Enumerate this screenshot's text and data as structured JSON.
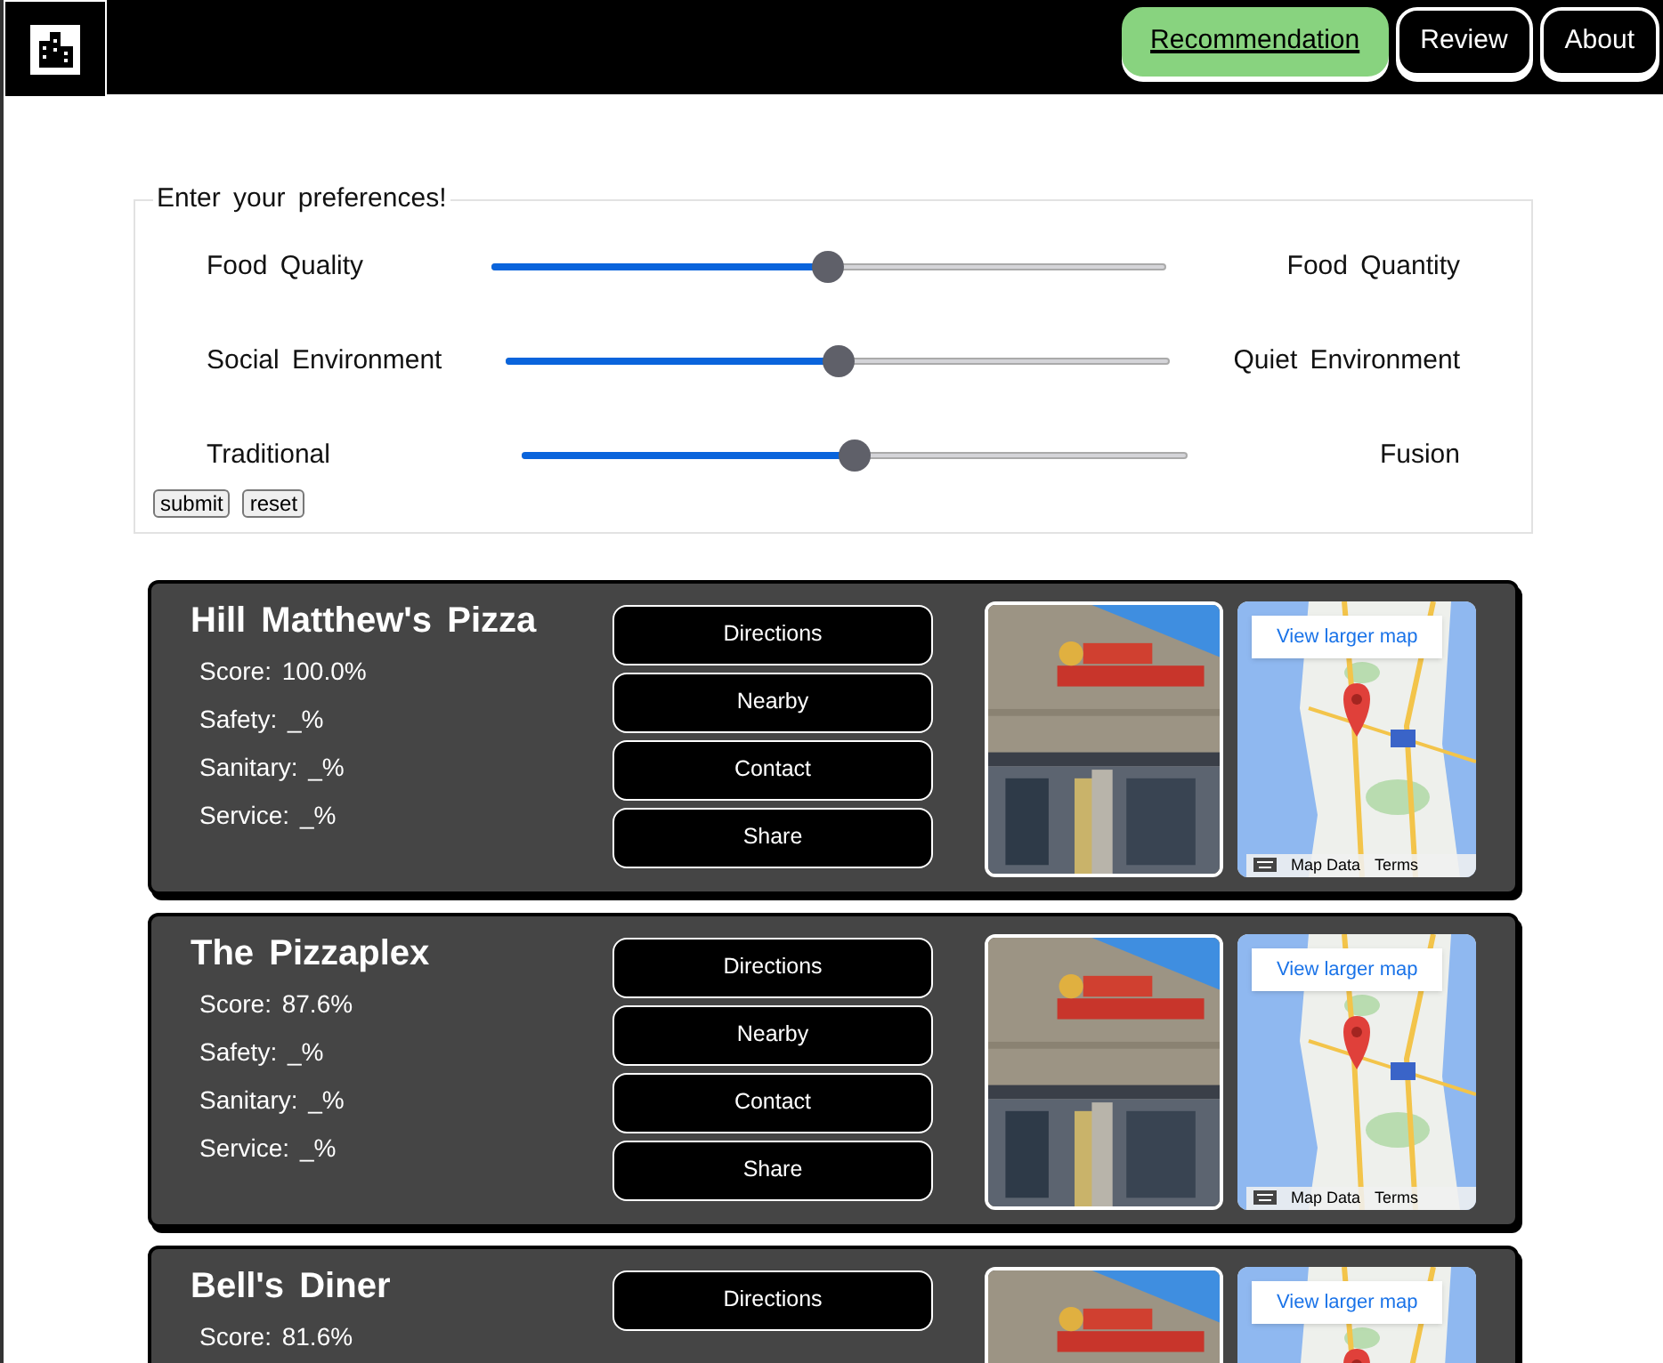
{
  "nav": {
    "items": [
      {
        "label": "Recommendation",
        "selected": true
      },
      {
        "label": "Review",
        "selected": false
      },
      {
        "label": "About",
        "selected": false
      }
    ]
  },
  "preferences": {
    "legend": "Enter your preferences!",
    "sliders": [
      {
        "left": "Food Quality",
        "right": "Food Quantity",
        "level": 0.5
      },
      {
        "left": "Social Environment",
        "right": "Quiet Environment",
        "level": 0.5
      },
      {
        "left": "Traditional",
        "right": "Fusion",
        "level": 0.5
      }
    ],
    "buttons": [
      "submit",
      "reset"
    ]
  },
  "results": [
    {
      "name": "Hill Matthew's Pizza",
      "stats": [
        "Score: 100.0%",
        "Safety: _%",
        "Sanitary: _%",
        "Service: _%"
      ],
      "actions": [
        "Directions",
        "Nearby",
        "Contact",
        "Share"
      ],
      "photo": {
        "kind": "picture"
      },
      "map": {
        "link": "View larger map",
        "footer": [
          "Map Data",
          "Terms"
        ]
      }
    },
    {
      "name": "The Pizzaplex",
      "stats": [
        "Score: 87.6%",
        "Safety: _%",
        "Sanitary: _%",
        "Service: _%"
      ],
      "actions": [
        "Directions",
        "Nearby",
        "Contact",
        "Share"
      ],
      "photo": {
        "kind": "picture"
      },
      "map": {
        "link": "View larger map",
        "footer": [
          "Map Data",
          "Terms"
        ]
      }
    },
    {
      "name": "Bell's Diner",
      "stats": [
        "Score: 81.6%"
      ],
      "actions": [
        "Directions"
      ],
      "photo": {
        "kind": "picture"
      },
      "map": {
        "link": "View larger map"
      }
    }
  ]
}
